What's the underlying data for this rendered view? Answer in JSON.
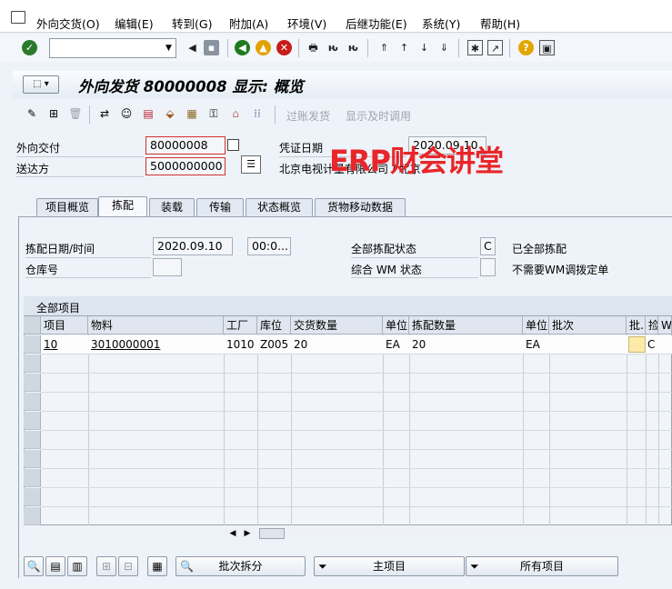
{
  "menu": [
    "外向交货(O)",
    "编辑(E)",
    "转到(G)",
    "附加(A)",
    "环境(V)",
    "后继功能(E)",
    "系统(Y)",
    "帮助(H)"
  ],
  "title": "外向发货 80000008 显示: 概览",
  "app_toolbar": {
    "post_goods_issue": "过账发货",
    "show_timely": "显示及时调用"
  },
  "header": {
    "delivery_label": "外向交付",
    "delivery_value": "80000008",
    "shipto_label": "送达方",
    "shipto_value": "5000000000",
    "shipto_name": "北京电视计量有限公司 / 北京",
    "docdate_label": "凭证日期",
    "docdate_value": "2020.09.10"
  },
  "watermark": "ERP财会讲堂",
  "tabs": [
    "项目概览",
    "拣配",
    "装载",
    "传输",
    "状态概览",
    "货物移动数据"
  ],
  "picking": {
    "date_label": "拣配日期/时间",
    "date_value": "2020.09.10",
    "time_value": "00:0...",
    "warehouse_label": "仓库号",
    "overall_label": "全部拣配状态",
    "overall_value": "C",
    "overall_text": "已全部拣配",
    "wm_label": "综合 WM 状态",
    "wm_text": "不需要WM调拨定单"
  },
  "grid": {
    "title": "全部项目",
    "columns": [
      "项目",
      "物料",
      "工厂",
      "库位",
      "交货数量",
      "单位",
      "拣配数量",
      "单位",
      "批次",
      "批...",
      "捡..",
      "W"
    ],
    "row": {
      "item": "10",
      "material": "3010000001",
      "plant": "1010",
      "sloc": "Z005",
      "qty": "20",
      "unit": "EA",
      "pick_qty": "20",
      "pick_unit": "EA",
      "batch": "",
      "status": "C"
    }
  },
  "bottom": {
    "batch_split": "批次拆分",
    "main_items": "主项目",
    "all_items": "所有项目"
  }
}
